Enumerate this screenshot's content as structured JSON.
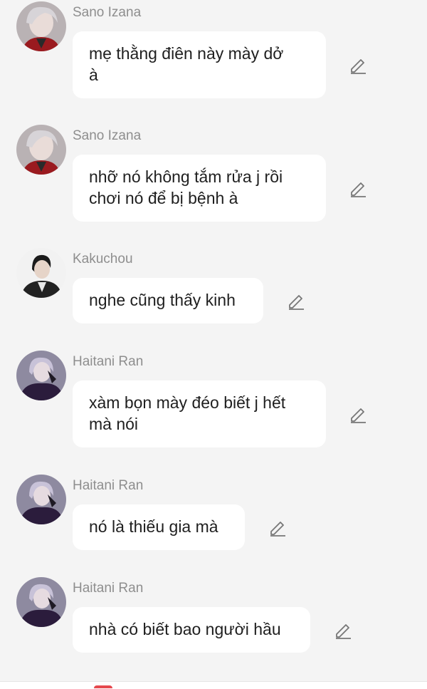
{
  "colors": {
    "background": "#f4f4f4",
    "bubble": "#ffffff",
    "sender_text": "#8e8e8e",
    "message_text": "#1f1f1f",
    "edit_icon": "#777777",
    "accent": "#e5484d"
  },
  "messages": [
    {
      "sender": "Sano Izana",
      "avatar": "izana-avatar",
      "text": "mẹ thằng điên này mày dở\nà",
      "icon": "pencil-icon"
    },
    {
      "sender": "Sano Izana",
      "avatar": "izana-avatar",
      "text": "nhỡ nó không tắm rửa j rồi\nchơi nó để bị bệnh à",
      "icon": "pencil-icon"
    },
    {
      "sender": "Kakuchou",
      "avatar": "kakuchou-avatar",
      "text": "nghe cũng thấy kinh",
      "icon": "pencil-icon"
    },
    {
      "sender": "Haitani Ran",
      "avatar": "ran-avatar",
      "text": "xàm bọn mày đéo biết j hết\nmà nói",
      "icon": "pencil-icon"
    },
    {
      "sender": "Haitani Ran",
      "avatar": "ran-avatar",
      "text": "nó là thiếu gia mà",
      "icon": "pencil-icon"
    },
    {
      "sender": "Haitani Ran",
      "avatar": "ran-avatar",
      "text": "nhà có biết bao người hầu",
      "icon": "pencil-icon"
    }
  ]
}
